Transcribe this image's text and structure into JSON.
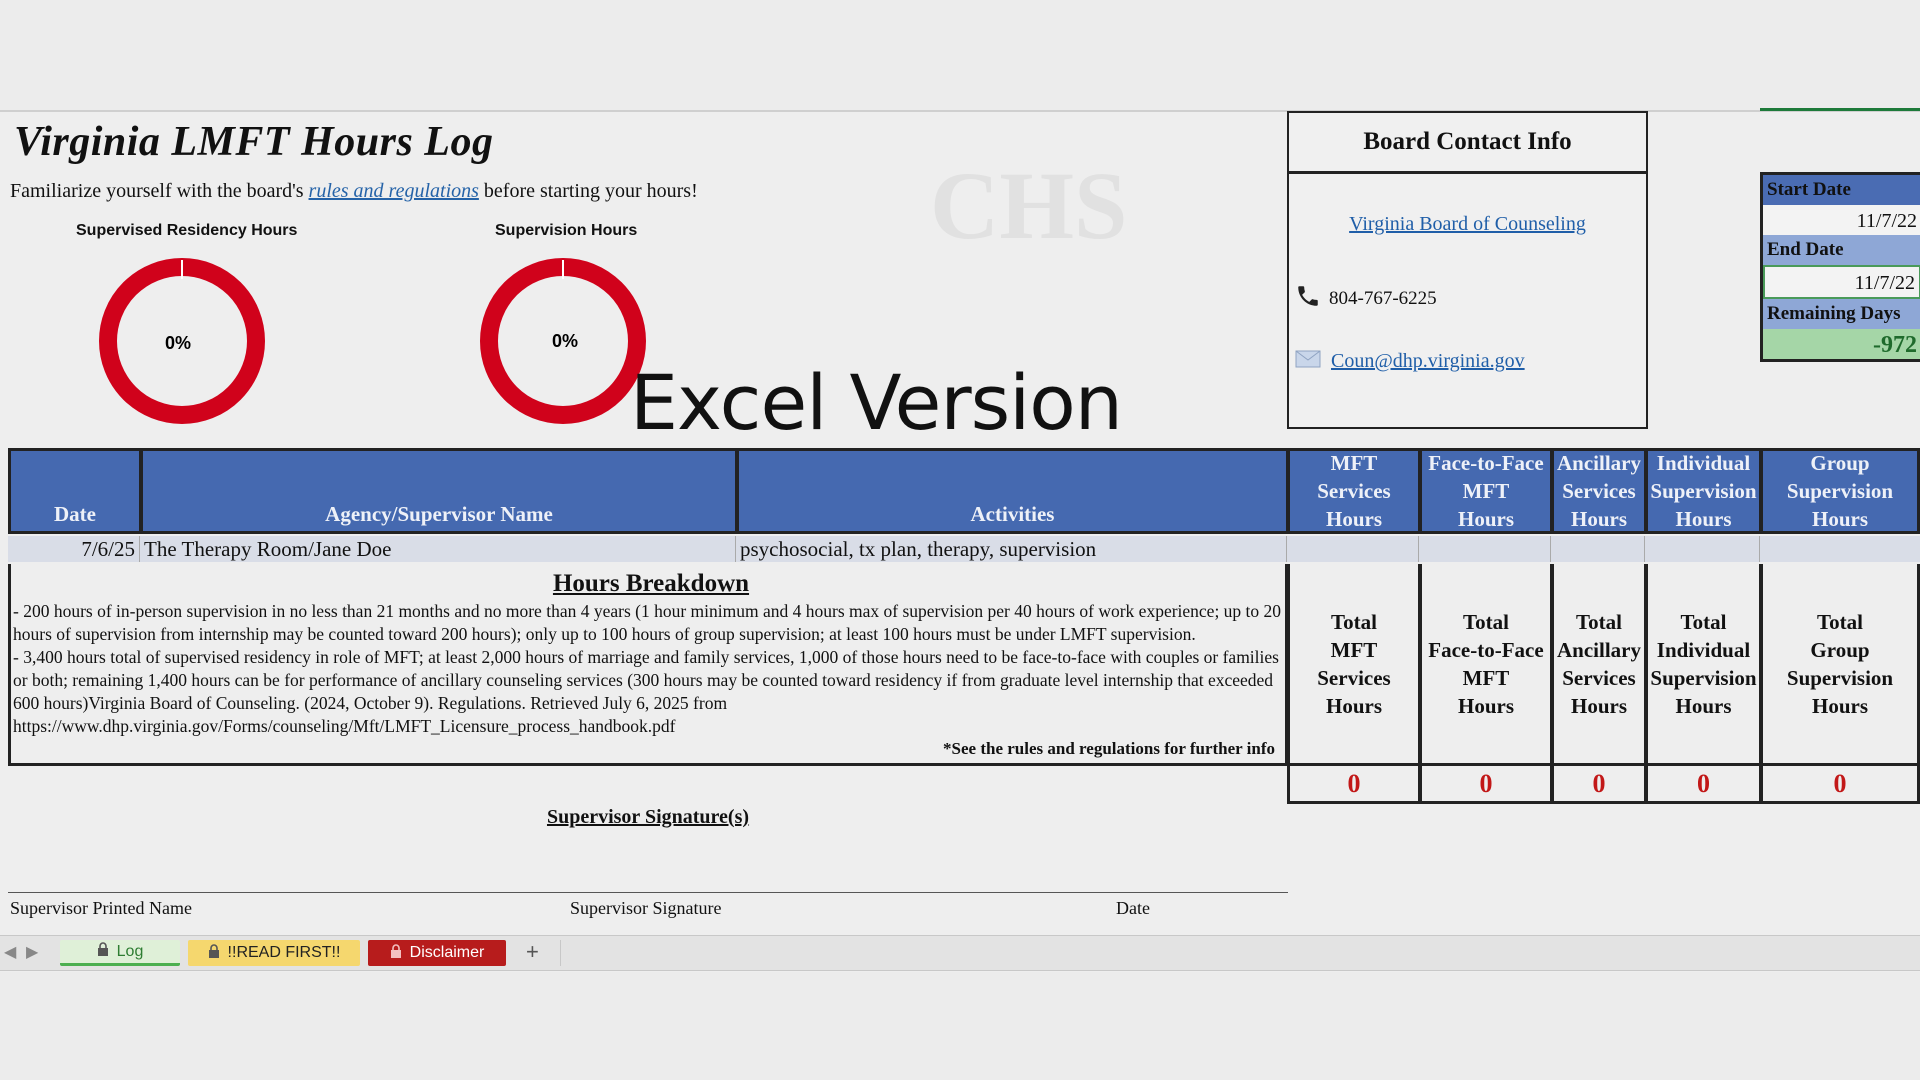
{
  "title": "Virginia LMFT Hours Log",
  "intro": {
    "before": "Familiarize yourself with the board's ",
    "link": "rules and regulations",
    "after": " before starting your hours!"
  },
  "gauges": [
    {
      "label": "Supervised Residency Hours",
      "value_text": "0%",
      "value": 0
    },
    {
      "label": "Supervision Hours",
      "value_text": "0%",
      "value": 0
    }
  ],
  "overlay_text": "Excel Version",
  "contact": {
    "title": "Board Contact Info",
    "board_link": "Virginia Board of Counseling",
    "phone": "804-767-6225",
    "email": "Coun@dhp.virginia.gov"
  },
  "dates": {
    "start_label": "Start Date",
    "start_value": "11/7/22",
    "end_label": "End Date",
    "end_value": "11/7/22",
    "remaining_label": "Remaining Days",
    "remaining_value": "-972"
  },
  "table": {
    "headers": [
      "Date",
      "Agency/Supervisor Name",
      "Activities",
      "MFT Services Hours",
      "Face-to-Face MFT Hours",
      "Ancillary Services Hours",
      "Individual Supervision Hours",
      "Group Supervision Hours"
    ],
    "header_lines": [
      [
        "MFT",
        "Services",
        "Hours"
      ],
      [
        "Face-to-Face",
        "MFT",
        "Hours"
      ],
      [
        "Ancillary",
        "Services",
        "Hours"
      ],
      [
        "Individual",
        "Supervision",
        "Hours"
      ],
      [
        "Group",
        "Supervision",
        "Hours"
      ]
    ],
    "rows": [
      {
        "date": "7/6/25",
        "agency": "The Therapy Room/Jane Doe",
        "activities": "psychosocial, tx plan, therapy, supervision"
      }
    ]
  },
  "breakdown": {
    "title": "Hours Breakdown",
    "text": "- 200 hours of in-person supervision in no less than 21 months and no more than 4 years (1 hour minimum and 4 hours max of supervision per 40 hours of work experience; up to 20 hours of supervision from internship may be counted toward 200 hours); only up to 100 hours of group supervision; at least 100 hours must be under LMFT supervision.\n- 3,400 hours total of supervised residency in role of MFT; at least 2,000 hours of marriage and family services, 1,000 of those hours need to be face-to-face with couples or families or both; remaining 1,400 hours can be for performance of ancillary counseling services (300 hours may be counted toward residency if from graduate level internship that exceeded 600 hours)Virginia Board of Counseling. (2024, October 9). Regulations. Retrieved July 6, 2025 from\nhttps://www.dhp.virginia.gov/Forms/counseling/Mft/LMFT_Licensure_process_handbook.pdf",
    "see_rules": "*See the rules and regulations for further info"
  },
  "totals": {
    "labels": [
      [
        "Total",
        "MFT",
        "Services",
        "Hours"
      ],
      [
        "Total",
        "Face-to-Face",
        "MFT",
        "Hours"
      ],
      [
        "Total",
        "Ancillary",
        "Services",
        "Hours"
      ],
      [
        "Total",
        "Individual",
        "Supervision",
        "Hours"
      ],
      [
        "Total",
        "Group",
        "Supervision",
        "Hours"
      ]
    ],
    "values": [
      "0",
      "0",
      "0",
      "0",
      "0"
    ]
  },
  "signature": {
    "title": "Supervisor Signature(s)",
    "printed_name": "Supervisor Printed Name",
    "signature": "Supervisor Signature",
    "date": "Date"
  },
  "tabs": [
    {
      "label": "Log",
      "color": "#dff0d8",
      "text_color": "#2e7d32",
      "icon": "lock-icon"
    },
    {
      "label": "!!READ FIRST!!",
      "color": "#f5d76e",
      "text_color": "#222222",
      "icon": "lock-icon"
    },
    {
      "label": "Disclaimer",
      "color": "#b71c1c",
      "text_color": "#ffffff",
      "icon": "lock-icon"
    }
  ],
  "add_sheet": "+",
  "colors": {
    "header_blue": "#4569b0",
    "gauge_red": "#d0021b",
    "total_red": "#c21818",
    "remaining_green": "#a5d6a7"
  }
}
